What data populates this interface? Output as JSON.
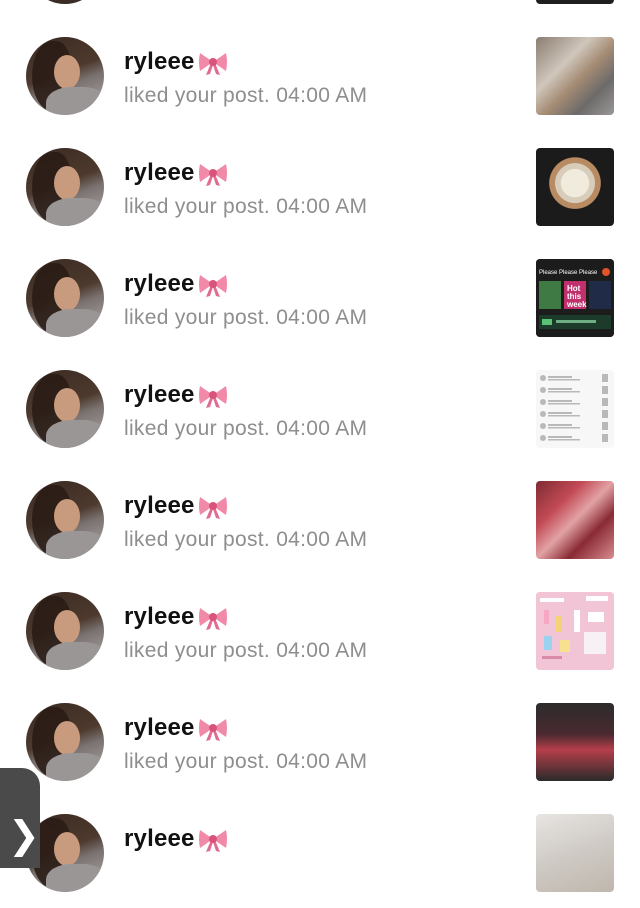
{
  "notifications": [
    {
      "username": "ryleee",
      "emoji": "bow",
      "action": "liked your post.",
      "time": "04:00 AM"
    },
    {
      "username": "ryleee",
      "emoji": "bow",
      "action": "liked your post.",
      "time": "04:00 AM"
    },
    {
      "username": "ryleee",
      "emoji": "bow",
      "action": "liked your post.",
      "time": "04:00 AM"
    },
    {
      "username": "ryleee",
      "emoji": "bow",
      "action": "liked your post.",
      "time": "04:00 AM"
    },
    {
      "username": "ryleee",
      "emoji": "bow",
      "action": "liked your post.",
      "time": "04:00 AM"
    },
    {
      "username": "ryleee",
      "emoji": "bow",
      "action": "liked your post.",
      "time": "04:00 AM"
    },
    {
      "username": "ryleee",
      "emoji": "bow",
      "action": "liked your post.",
      "time": "04:00 AM"
    },
    {
      "username": "ryleee",
      "emoji": "bow"
    }
  ],
  "thumb_texts": {
    "t2_title": "Please Please Please",
    "t2_word1": "Hot",
    "t2_word2": "this",
    "t2_word3": "week"
  },
  "back_glyph": "❯",
  "colors": {
    "bow_pink": "#f08aa8",
    "secondary_text": "#8e8e8e"
  }
}
